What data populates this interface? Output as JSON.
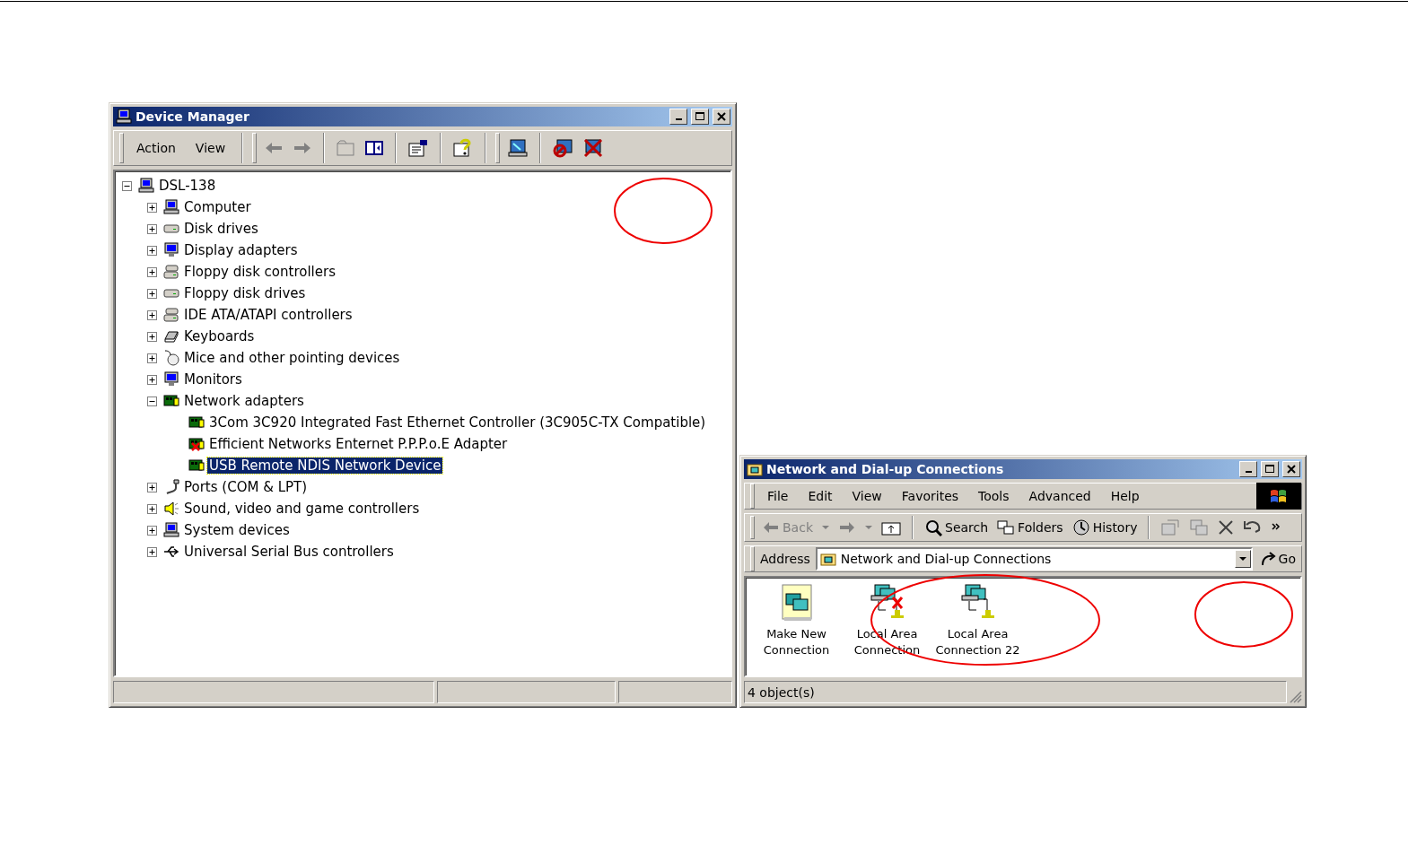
{
  "device_manager": {
    "title": "Device Manager",
    "menu": [
      "Action",
      "View"
    ],
    "tree": {
      "label": "DSL-138",
      "kind": "computer",
      "expanded": true,
      "selected": false,
      "children": [
        {
          "label": "Computer",
          "kind": "computer",
          "expanded": false,
          "selected": false
        },
        {
          "label": "Disk drives",
          "kind": "drive",
          "expanded": false,
          "selected": false
        },
        {
          "label": "Display adapters",
          "kind": "monitor",
          "expanded": false,
          "selected": false
        },
        {
          "label": "Floppy disk controllers",
          "kind": "controller",
          "expanded": false,
          "selected": false
        },
        {
          "label": "Floppy disk drives",
          "kind": "drive",
          "expanded": false,
          "selected": false
        },
        {
          "label": "IDE ATA/ATAPI controllers",
          "kind": "controller",
          "expanded": false,
          "selected": false
        },
        {
          "label": "Keyboards",
          "kind": "keyboard",
          "expanded": false,
          "selected": false
        },
        {
          "label": "Mice and other pointing devices",
          "kind": "mouse",
          "expanded": false,
          "selected": false
        },
        {
          "label": "Monitors",
          "kind": "monitor",
          "expanded": false,
          "selected": false
        },
        {
          "label": "Network adapters",
          "kind": "card",
          "expanded": true,
          "selected": false,
          "children": [
            {
              "label": "3Com 3C920 Integrated Fast Ethernet Controller (3C905C-TX Compatible)",
              "kind": "card",
              "selected": false,
              "disabled": false
            },
            {
              "label": "Efficient Networks Enternet P.P.P.o.E Adapter",
              "kind": "card",
              "selected": false,
              "disabled": true
            },
            {
              "label": "USB Remote NDIS Network Device",
              "kind": "card",
              "selected": true,
              "disabled": false
            }
          ]
        },
        {
          "label": "Ports (COM & LPT)",
          "kind": "port",
          "expanded": false,
          "selected": false
        },
        {
          "label": "Sound, video and game controllers",
          "kind": "speaker",
          "expanded": false,
          "selected": false
        },
        {
          "label": "System devices",
          "kind": "computer",
          "expanded": false,
          "selected": false
        },
        {
          "label": "Universal Serial Bus controllers",
          "kind": "usb",
          "expanded": false,
          "selected": false
        }
      ]
    }
  },
  "network_connections": {
    "title": "Network and Dial-up Connections",
    "menu": [
      "File",
      "Edit",
      "View",
      "Favorites",
      "Tools",
      "Advanced",
      "Help"
    ],
    "toolbar": {
      "back": {
        "label": "Back",
        "disabled": true
      },
      "search": "Search",
      "folders": "Folders",
      "history": "History"
    },
    "address": {
      "label": "Address",
      "value": "Network and Dial-up Connections",
      "go": "Go"
    },
    "items": [
      {
        "label": "Make New Connection",
        "kind": "wizard",
        "disabled": false
      },
      {
        "label": "Local Area Connection",
        "kind": "connection",
        "disabled": true
      },
      {
        "label": "Local Area Connection 22",
        "kind": "connection",
        "disabled": false
      }
    ],
    "status_bar": "4 object(s)"
  }
}
